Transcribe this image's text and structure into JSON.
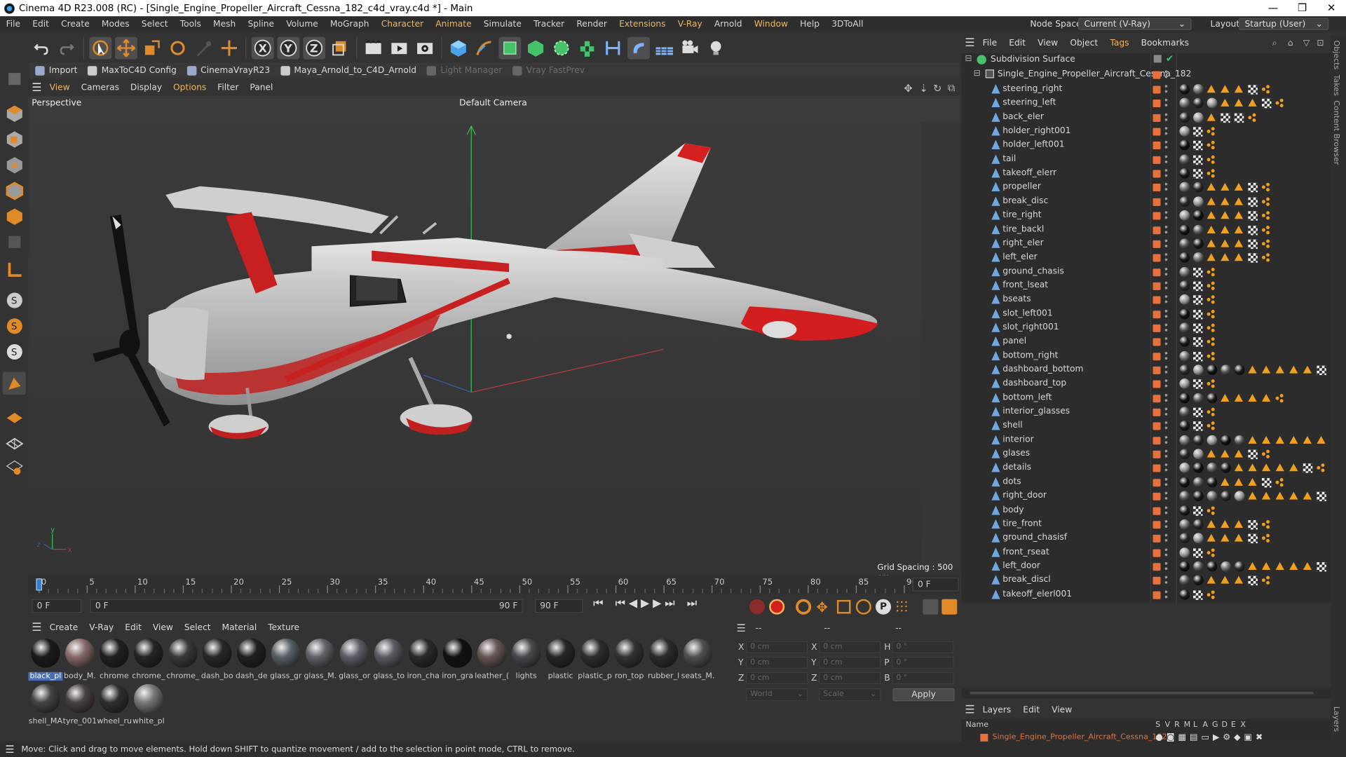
{
  "window": {
    "title": "Cinema 4D R23.008 (RC) - [Single_Engine_Propeller_Aircraft_Cessna_182_c4d_vray.c4d *] - Main",
    "minimize": "—",
    "maximize": "❐",
    "close": "✕"
  },
  "menubar": {
    "items": [
      "File",
      "Edit",
      "Create",
      "Modes",
      "Select",
      "Tools",
      "Mesh",
      "Spline",
      "Volume",
      "MoGraph",
      "Character",
      "Animate",
      "Simulate",
      "Tracker",
      "Render",
      "Extensions",
      "V-Ray",
      "Arnold",
      "Window",
      "Help",
      "3DToAll"
    ],
    "node_space_label": "Node Space:",
    "node_space_value": "Current (V-Ray)",
    "layout_label": "Layout:",
    "layout_value": "Startup (User)"
  },
  "plugins": [
    "Import",
    "MaxToC4D Config",
    "CinemaVrayR23",
    "Maya_Arnold_to_C4D_Arnold",
    "Light Manager",
    "Vray FastPrev"
  ],
  "viewport": {
    "menu": [
      "View",
      "Cameras",
      "Display",
      "Options",
      "Filter",
      "Panel"
    ],
    "name": "Perspective",
    "camera": "Default Camera",
    "grid_spacing": "Grid Spacing : 500 cm"
  },
  "timeline": {
    "ticks": [
      "0",
      "5",
      "10",
      "15",
      "20",
      "25",
      "30",
      "35",
      "40",
      "45",
      "50",
      "55",
      "60",
      "65",
      "70",
      "75",
      "80",
      "85",
      "90"
    ],
    "current_frame": "0 F"
  },
  "playback": {
    "start": "0 F",
    "current": "0 F",
    "end1": "90 F",
    "end2": "90 F"
  },
  "materials": {
    "menu": [
      "Create",
      "V-Ray",
      "Edit",
      "View",
      "Select",
      "Material",
      "Texture"
    ],
    "items": [
      {
        "name": "black_pl",
        "color": "#1a1a1a"
      },
      {
        "name": "body_M.",
        "color": "#8a6a6a"
      },
      {
        "name": "chrome",
        "color": "#202020"
      },
      {
        "name": "chrome_",
        "color": "#252525"
      },
      {
        "name": "chrome_",
        "color": "#3a3a3a"
      },
      {
        "name": "dash_bo",
        "color": "#282828"
      },
      {
        "name": "dash_de",
        "color": "#202020"
      },
      {
        "name": "glass_gr",
        "color": "#5a6068"
      },
      {
        "name": "glass_M.",
        "color": "#606468"
      },
      {
        "name": "glass_or",
        "color": "#5c6066"
      },
      {
        "name": "glass_to",
        "color": "#5a5e64"
      },
      {
        "name": "iron_cha",
        "color": "#2a2a2a"
      },
      {
        "name": "iron_gra",
        "color": "#111111"
      },
      {
        "name": "leather_(",
        "color": "#6a5656"
      },
      {
        "name": "lights",
        "color": "#4a4a50"
      },
      {
        "name": "plastic",
        "color": "#262626"
      },
      {
        "name": "plastic_p",
        "color": "#2e2e2e"
      },
      {
        "name": "ron_top",
        "color": "#333333"
      },
      {
        "name": "rubber_l",
        "color": "#2c2c2c"
      },
      {
        "name": "seats_M.",
        "color": "#505050"
      },
      {
        "name": "shell_MA",
        "color": "#454545"
      },
      {
        "name": "tyre_001",
        "color": "#4a4242"
      },
      {
        "name": "wheel_ru",
        "color": "#303030"
      },
      {
        "name": "white_pl",
        "color": "#7a7a7a"
      }
    ]
  },
  "coords": {
    "header_a": "--",
    "header_b": "--",
    "header_c": "--",
    "x": "X",
    "y": "Y",
    "z": "Z",
    "h": "H",
    "p": "P",
    "b": "B",
    "x_pos": "0 cm",
    "y_pos": "0 cm",
    "z_pos": "0 cm",
    "x_size": "0 cm",
    "y_size": "0 cm",
    "z_size": "0 cm",
    "h_rot": "0 °",
    "p_rot": "0 °",
    "b_rot": "0 °",
    "space": "World",
    "mode": "Scale",
    "apply": "Apply"
  },
  "object_manager": {
    "menu": [
      "File",
      "Edit",
      "View",
      "Object",
      "Tags",
      "Bookmarks"
    ],
    "root": "Subdivision Surface",
    "parent": "Single_Engine_Propeller_Aircraft_Cessna_182",
    "objects": [
      "steering_right",
      "steering_left",
      "back_eler",
      "holder_right001",
      "holder_left001",
      "tail",
      "takeoff_elerr",
      "propeller",
      "break_disc",
      "tire_right",
      "tire_backl",
      "right_eler",
      "left_eler",
      "ground_chasis",
      "front_lseat",
      "bseats",
      "slot_left001",
      "slot_right001",
      "panel",
      "bottom_right",
      "dashboard_bottom",
      "dashboard_top",
      "bottom_left",
      "interior_glasses",
      "shell",
      "interior",
      "glases",
      "details",
      "dots",
      "right_door",
      "body",
      "tire_front",
      "ground_chasisf",
      "front_rseat",
      "left_door",
      "break_discl",
      "takeoff_elerl001"
    ]
  },
  "layers": {
    "menu": [
      "Layers",
      "Edit",
      "View"
    ],
    "name_col": "Name",
    "cols": [
      "S",
      "V",
      "R",
      "M",
      "L",
      "A",
      "G",
      "D",
      "E",
      "X"
    ],
    "layer_name": "Single_Engine_Propeller_Aircraft_Cessna_182",
    "layer_color": "#e8703a"
  },
  "side_tabs": [
    "Objects",
    "Takes",
    "Content Browser",
    "Layers"
  ],
  "status": "Move: Click and drag to move elements. Hold down SHIFT to quantize movement / add to the selection in point mode, CTRL to remove.",
  "colors": {
    "accent": "#f0b75a",
    "orange_tag": "#e8703a",
    "selection": "#4a6fb5"
  }
}
